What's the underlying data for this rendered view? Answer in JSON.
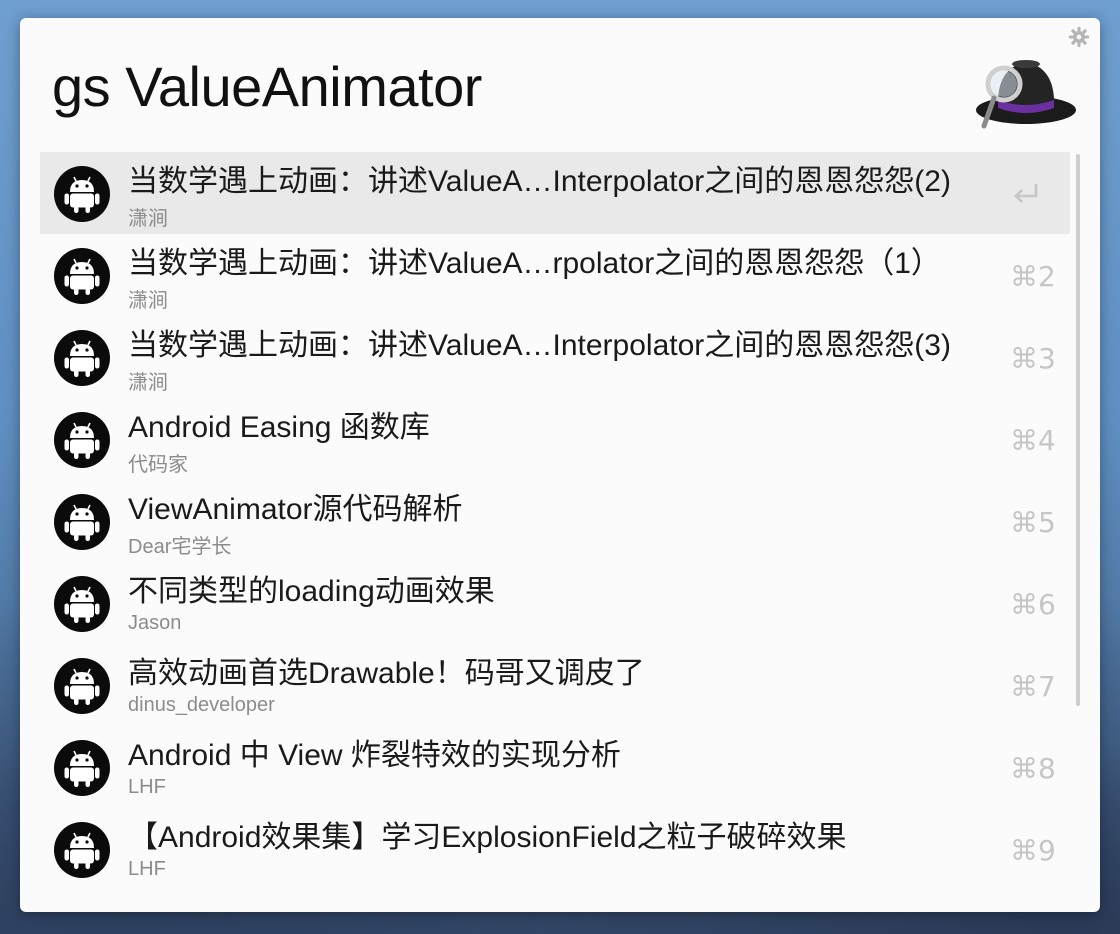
{
  "query": "gs ValueAnimator",
  "results": [
    {
      "title": "当数学遇上动画：讲述ValueA…Interpolator之间的恩恩怨怨(2)",
      "subtitle": "潇涧",
      "shortcut": "↩",
      "selected": true
    },
    {
      "title": "当数学遇上动画：讲述ValueA…rpolator之间的恩恩怨怨（1）",
      "subtitle": "潇涧",
      "shortcut": "⌘2"
    },
    {
      "title": "当数学遇上动画：讲述ValueA…Interpolator之间的恩恩怨怨(3)",
      "subtitle": "潇涧",
      "shortcut": "⌘3"
    },
    {
      "title": "Android Easing 函数库",
      "subtitle": "代码家",
      "shortcut": "⌘4"
    },
    {
      "title": "ViewAnimator源代码解析",
      "subtitle": "Dear宅学长",
      "shortcut": "⌘5"
    },
    {
      "title": "不同类型的loading动画效果",
      "subtitle": "Jason",
      "shortcut": "⌘6"
    },
    {
      "title": "高效动画首选Drawable！码哥又调皮了",
      "subtitle": "dinus_developer",
      "shortcut": "⌘7"
    },
    {
      "title": "Android 中 View 炸裂特效的实现分析",
      "subtitle": "LHF",
      "shortcut": "⌘8"
    },
    {
      "title": "【Android效果集】学习ExplosionField之粒子破碎效果",
      "subtitle": "LHF",
      "shortcut": "⌘9"
    }
  ],
  "icons": {
    "result_icon": "android-icon",
    "settings": "gear-icon",
    "app_logo": "alfred-hat-logo",
    "return": "return-icon"
  },
  "colors": {
    "selected_row": "#e9e9e9",
    "title_text": "#1a1a1a",
    "subtitle_text": "#8c8c8c",
    "shortcut_text": "#c6c6c6",
    "hat_band": "#6b2fa0"
  }
}
